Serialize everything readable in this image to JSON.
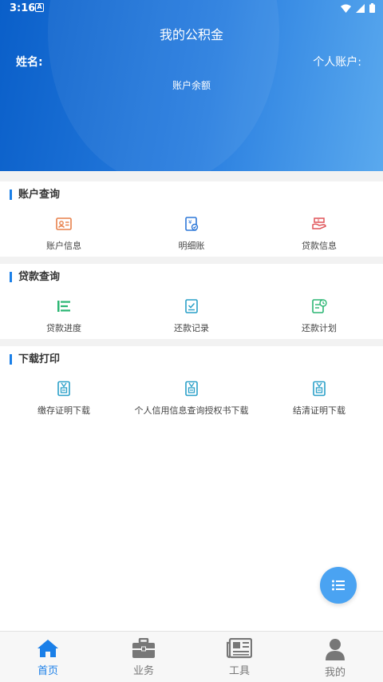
{
  "status_bar": {
    "time": "3:16",
    "notification_glyph": "A"
  },
  "header": {
    "title": "我的公积金",
    "name_label": "姓名:",
    "account_label": "个人账户:",
    "balance_label": "账户余额"
  },
  "sections": [
    {
      "title": "账户查询",
      "items": [
        {
          "label": "账户信息",
          "icon": "id-card-icon"
        },
        {
          "label": "明细账",
          "icon": "ledger-icon"
        },
        {
          "label": "贷款信息",
          "icon": "loan-info-icon"
        }
      ]
    },
    {
      "title": "贷款查询",
      "items": [
        {
          "label": "贷款进度",
          "icon": "progress-list-icon"
        },
        {
          "label": "还款记录",
          "icon": "record-icon"
        },
        {
          "label": "还款计划",
          "icon": "plan-clock-icon"
        }
      ]
    },
    {
      "title": "下载打印",
      "items": [
        {
          "label": "缴存证明下载",
          "icon": "certificate-icon"
        },
        {
          "label": "个人信用信息查询授权书下载",
          "icon": "certificate-icon"
        },
        {
          "label": "结清证明下载",
          "icon": "certificate-icon"
        }
      ]
    }
  ],
  "tabs": [
    {
      "label": "首页",
      "icon": "home-icon",
      "active": true
    },
    {
      "label": "业务",
      "icon": "briefcase-icon",
      "active": false
    },
    {
      "label": "工具",
      "icon": "newspaper-icon",
      "active": false
    },
    {
      "label": "我的",
      "icon": "person-icon",
      "active": false
    }
  ],
  "colors": {
    "accent": "#1a7fe8",
    "header_start": "#0a5fc9",
    "header_end": "#5aa9ee",
    "fab": "#4aa3f2",
    "orange_icon": "#e8804a",
    "blue_icon": "#2e78d8",
    "red_icon": "#e0555a",
    "green_icon": "#2bb673",
    "teal_icon": "#2aa0c8"
  }
}
